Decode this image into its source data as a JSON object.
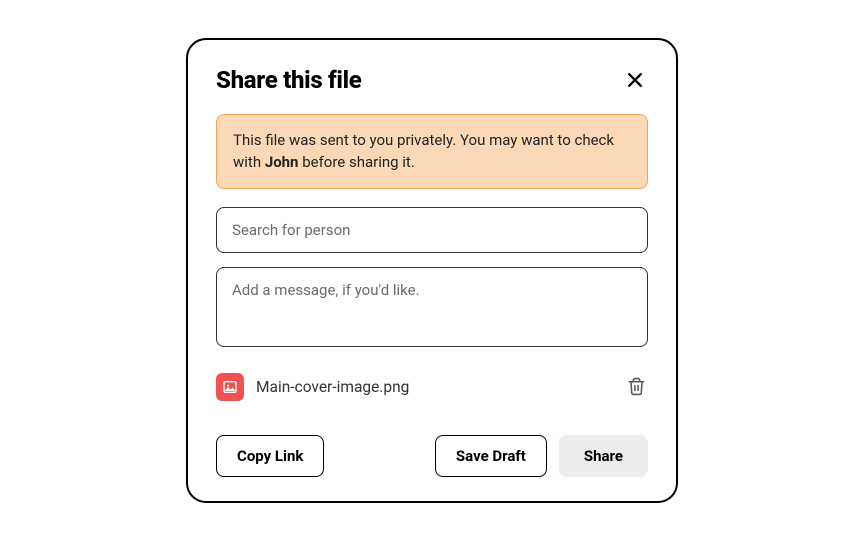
{
  "modal": {
    "title": "Share this file",
    "warning": {
      "prefix": "This file was sent to you privately. You may want to check with ",
      "bold": "John",
      "suffix": " before sharing it."
    },
    "search": {
      "placeholder": "Search for person",
      "value": ""
    },
    "message": {
      "placeholder": "Add a message, if you'd like.",
      "value": ""
    },
    "attachment": {
      "name": "Main-cover-image.png"
    },
    "buttons": {
      "copy_link": "Copy Link",
      "save_draft": "Save Draft",
      "share": "Share"
    }
  }
}
